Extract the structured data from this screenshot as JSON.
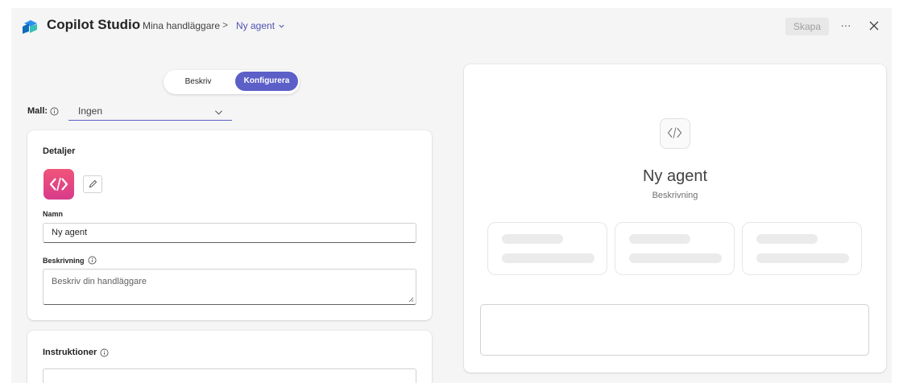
{
  "header": {
    "app_name": "Copilot Studio",
    "breadcrumb": {
      "parent": "Mina handläggare",
      "separator": ">",
      "current": "Ny agent"
    },
    "create_label": "Skapa",
    "more_label": "···"
  },
  "mode_toggle": {
    "options": [
      "Beskriv",
      "Konfigurera"
    ],
    "selected": "Konfigurera"
  },
  "template": {
    "label": "Mall:",
    "value": "Ingen"
  },
  "details": {
    "title": "Detaljer",
    "name_label": "Namn",
    "name_value": "Ny agent",
    "description_label": "Beskrivning",
    "description_placeholder": "Beskriv din handläggare"
  },
  "instructions": {
    "title": "Instruktioner"
  },
  "preview": {
    "agent_name": "Ny agent",
    "agent_description": "Beskrivning"
  },
  "colors": {
    "accent": "#5b5fc7",
    "icon_gradient_top": "#f0547a",
    "icon_gradient_bottom": "#d83b8a"
  }
}
